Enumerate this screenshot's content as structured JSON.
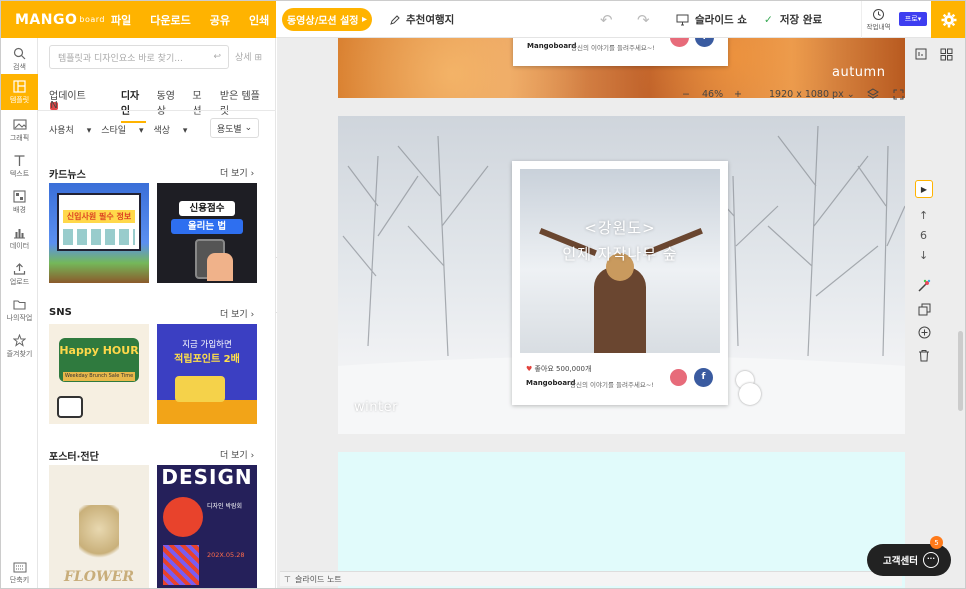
{
  "app": {
    "logo": "MANGO",
    "logo_sub": "board"
  },
  "topmenu": [
    "파일",
    "다운로드",
    "공유",
    "인쇄"
  ],
  "toolbar": {
    "motion_button": "동영상/모션 설정",
    "recommend": "추천여행지",
    "slideshow": "슬라이드 쇼",
    "saved": "저장 완료",
    "history": "작업내역",
    "pro": "프로"
  },
  "iconbar": [
    "검색",
    "템플릿",
    "그래픽",
    "텍스트",
    "배경",
    "데이터",
    "업로드",
    "나의작업",
    "즐겨찾기",
    "단축키"
  ],
  "panel": {
    "search_placeholder": "템플릿과 디자인요소 바로 찾기...",
    "detail": "상세",
    "tabs": [
      "업데이트",
      "디자인",
      "동영상",
      "모션",
      "받은 템플릿"
    ],
    "active_tab": "디자인",
    "filters": [
      "사용처",
      "스타일",
      "색상"
    ],
    "usage": "용도별",
    "more": "더 보기",
    "sections": [
      {
        "title": "카드뉴스",
        "thumbs": [
          {
            "title": "신입사원 필수 정보",
            "label": ""
          },
          {
            "title": "신용점수",
            "subtitle": "올리는 법"
          }
        ]
      },
      {
        "title": "SNS",
        "thumbs": [
          {
            "title": "Happy HOUR",
            "subtitle": "Weekday Brunch Sale Time"
          },
          {
            "title": "지금 가입하면",
            "subtitle": "적립포인트 2배"
          }
        ]
      },
      {
        "title": "포스터·전단",
        "thumbs": [
          {
            "title": "FLOWER",
            "subtitle": ""
          },
          {
            "title": "DESIGN",
            "subtitle": "디자인 박람회",
            "date": "202X.05.28"
          }
        ]
      }
    ]
  },
  "zoom": {
    "minus": "−",
    "value": "46%",
    "plus": "+",
    "size": "1920 x 1080 px"
  },
  "slides": {
    "top_label": "autumn",
    "mid_label": "winter",
    "card_title_line1": "<강원도>",
    "card_title_line2": "인제 자작나무 숲",
    "likes": "좋아요 500,000개",
    "brand": "Mangoboard",
    "caption": "당신의 이야기를 들려주세요~!"
  },
  "rightbar": {
    "page": "6"
  },
  "support": {
    "label": "고객센터",
    "badge": "5"
  },
  "notebar": {
    "label": "슬라이드 노트"
  },
  "colors": {
    "accent": "#ffb300",
    "pro": "#3d3df0",
    "snow_sky": "#dfe3e8",
    "empty_slide": "#e1fbfb"
  }
}
